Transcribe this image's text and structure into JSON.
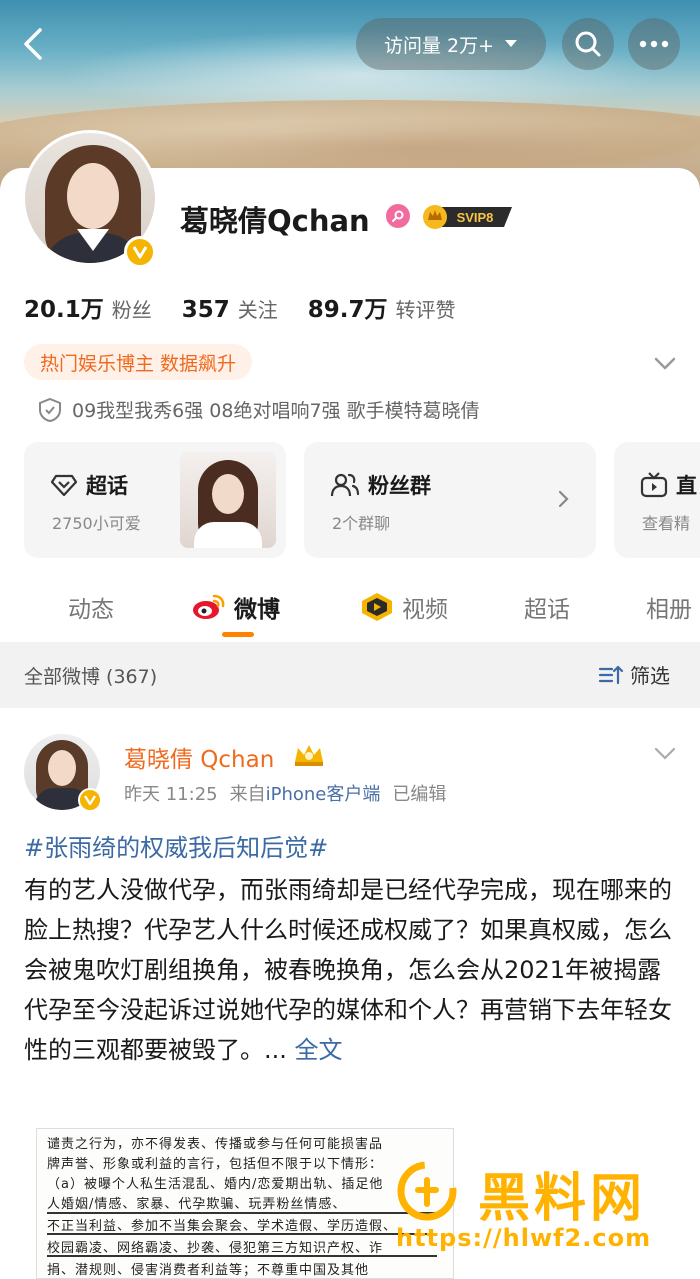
{
  "header": {
    "visits_label": "访问量 2万+"
  },
  "profile": {
    "name": "葛晓倩Qchan",
    "svip_label": "SVIP8",
    "stats": [
      {
        "num": "20.1万",
        "label": "粉丝"
      },
      {
        "num": "357",
        "label": "关注"
      },
      {
        "num": "89.7万",
        "label": "转评赞"
      }
    ],
    "hot_tag": "热门娱乐博主 数据飙升",
    "bio": "09我型我秀6强 08绝对唱响7强 歌手模特葛晓倩"
  },
  "cards": {
    "super": {
      "title": "超话",
      "sub": "2750小可爱"
    },
    "fans": {
      "title": "粉丝群",
      "sub": "2个群聊"
    },
    "live": {
      "title": "直",
      "sub": "查看精"
    }
  },
  "tabs": [
    "动态",
    "微博",
    "视频",
    "超话",
    "相册"
  ],
  "filter": {
    "count_label": "全部微博 (367)",
    "filter_label": "筛选"
  },
  "post": {
    "author": "葛晓倩 Qchan",
    "time": "昨天 11:25",
    "source_prefix": "来自",
    "source": "iPhone客户端",
    "edited": "已编辑",
    "hashtag": "#张雨绮的权威我后知后觉#",
    "body": "有的艺人没做代孕，而张雨绮却是已经代孕完成，现在哪来的脸上热搜？代孕艺人什么时候还成权威了？如果真权威，怎么会被鬼吹灯剧组换角，被春晚换角，怎么会从2021年被揭露代孕至今没起诉过说她代孕的媒体和个人？再营销下去年轻女性的三观都要被毁了。...",
    "more": "全文",
    "doc_lines": [
      "谴责之行为，亦不得发表、传播或参与任何可能损害品",
      "牌声誉、形象或利益的言行，包括但不限于以下情形：",
      "（a）被曝个人私生活混乱、婚内/恋爱期出轨、插足他",
      "人婚姻/情感、家暴、代孕欺骗、玩弄粉丝情感、",
      "不正当利益、参加不当集会聚会、学术造假、学历造假、",
      "校园霸凌、网络霸凌、抄袭、侵犯第三方知识产权、诈",
      "捐、潜规则、侵害消费者利益等；不尊重中国及其他"
    ]
  },
  "watermark": {
    "title": "黑料网",
    "url": "https://hlwf2.com"
  },
  "colors": {
    "accent": "#ff8200",
    "link": "#3b6aa5",
    "hot_tag": "#f06a1e",
    "verify": "#f5b400"
  }
}
